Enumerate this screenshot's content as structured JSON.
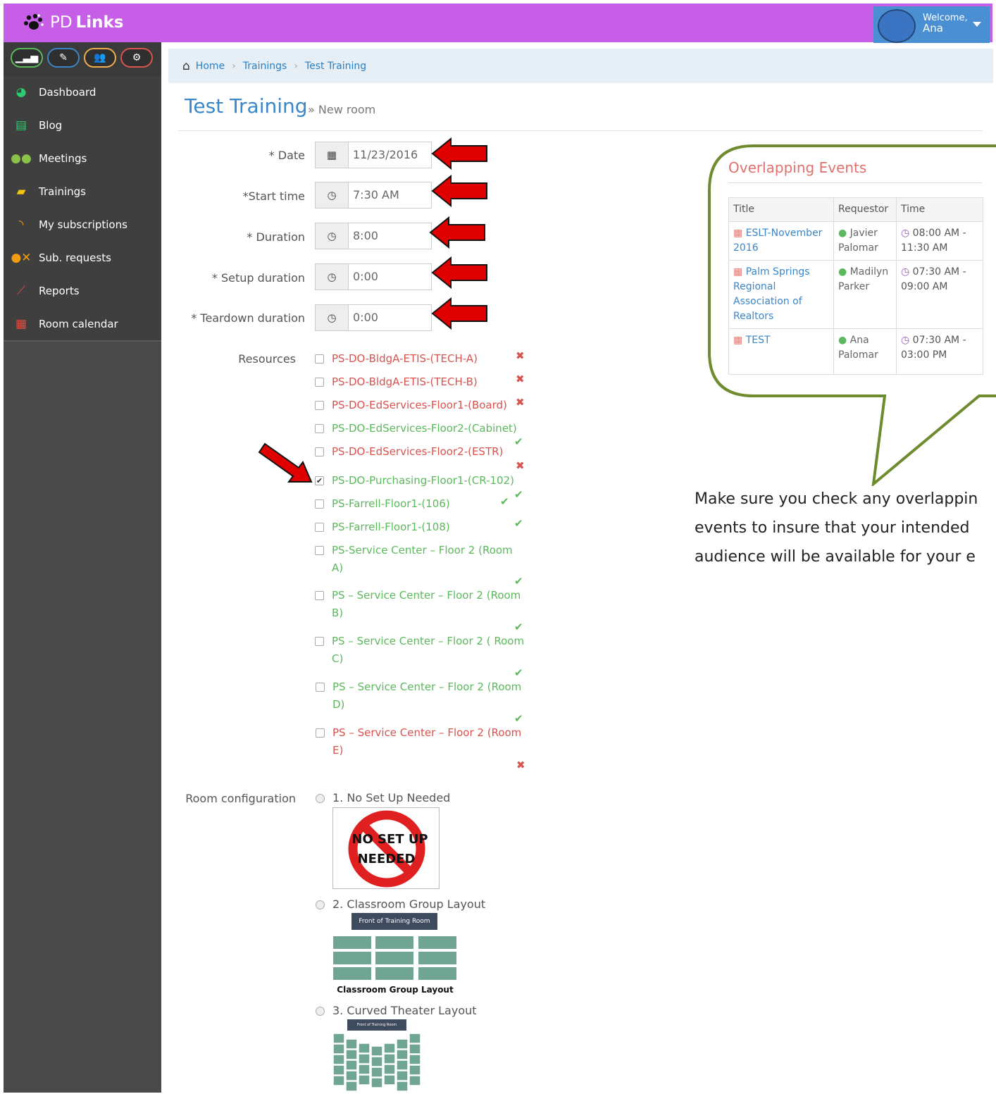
{
  "brand": {
    "name_light": "PD",
    "name_bold": "Links"
  },
  "user": {
    "welcome": "Welcome,",
    "name": "Ana"
  },
  "sidebar": {
    "items": [
      {
        "label": "Dashboard",
        "icon": "dashboard-icon",
        "color": "#2ecc71"
      },
      {
        "label": "Blog",
        "icon": "newspaper-icon",
        "color": "#2ecc71"
      },
      {
        "label": "Meetings",
        "icon": "users-icon",
        "color": "#8bc34a"
      },
      {
        "label": "Trainings",
        "icon": "book-icon",
        "color": "#f1c40f"
      },
      {
        "label": "My subscriptions",
        "icon": "rss-icon",
        "color": "#f39c12"
      },
      {
        "label": "Sub. requests",
        "icon": "user-x-icon",
        "color": "#f39c12"
      },
      {
        "label": "Reports",
        "icon": "chart-icon",
        "color": "#e74c3c"
      },
      {
        "label": "Room calendar",
        "icon": "calendar-icon",
        "color": "#e74c3c"
      }
    ]
  },
  "breadcrumb": {
    "home": "Home",
    "trainings": "Trainings",
    "current": "Test Training"
  },
  "page": {
    "title": "Test Training",
    "subtitle": "» New room"
  },
  "form": {
    "required": "*",
    "date": {
      "label": "Date",
      "value": "11/23/2016"
    },
    "start_time": {
      "label": "Start time",
      "value": "7:30 AM"
    },
    "duration": {
      "label": "Duration",
      "value": "8:00"
    },
    "setup_duration": {
      "label": "Setup duration",
      "value": "0:00"
    },
    "teardown_duration": {
      "label": "Teardown duration",
      "value": "0:00"
    },
    "resources_label": "Resources",
    "resources": [
      {
        "name": "PS-DO-BldgA-ETIS-(TECH-A)",
        "available": false,
        "checked": false
      },
      {
        "name": "PS-DO-BldgA-ETIS-(TECH-B)",
        "available": false,
        "checked": false
      },
      {
        "name": "PS-DO-EdServices-Floor1-(Board)",
        "available": false,
        "checked": false
      },
      {
        "name": "PS-DO-EdServices-Floor2-(Cabinet)",
        "available": true,
        "checked": false
      },
      {
        "name": "PS-DO-EdServices-Floor2-(ESTR)",
        "available": false,
        "checked": false
      },
      {
        "name": "PS-DO-Purchasing-Floor1-(CR-102)",
        "available": true,
        "checked": true
      },
      {
        "name": "PS-Farrell-Floor1-(106)",
        "available": true,
        "checked": false
      },
      {
        "name": "PS-Farrell-Floor1-(108)",
        "available": true,
        "checked": false
      },
      {
        "name": "PS-Service Center – Floor 2 (Room A)",
        "available": true,
        "checked": false
      },
      {
        "name": "PS – Service Center – Floor 2 (Room B)",
        "available": true,
        "checked": false
      },
      {
        "name": "PS – Service Center – Floor 2 ( Room C)",
        "available": true,
        "checked": false
      },
      {
        "name": "PS – Service Center – Floor 2 (Room D)",
        "available": true,
        "checked": false
      },
      {
        "name": "PS – Service Center – Floor 2 (Room E)",
        "available": false,
        "checked": false
      }
    ],
    "room_config_label": "Room configuration",
    "room_configs": [
      {
        "label": "1. No Set Up Needed",
        "image_text_1": "NO SET UP",
        "image_text_2": "NEEDED"
      },
      {
        "label": "2. Classroom Group Layout",
        "image_header": "Front of Training Room",
        "image_caption": "Classroom Group Layout"
      },
      {
        "label": "3. Curved Theater Layout",
        "image_header": "Front of Training Room"
      }
    ]
  },
  "overlapping": {
    "title": "Overlapping Events",
    "columns": [
      "Title",
      "Requestor",
      "Time"
    ],
    "rows": [
      {
        "title": "ESLT-November 2016",
        "requestor": "Javier Palomar",
        "time": "08:00 AM - 11:30 AM"
      },
      {
        "title": "Palm Springs Regional Association of Realtors",
        "requestor": "Madilyn Parker",
        "time": "07:30 AM - 09:00 AM"
      },
      {
        "title": "TEST",
        "requestor": "Ana Palomar",
        "time": "07:30 AM - 03:00 PM"
      }
    ]
  },
  "callout": {
    "line1": "Make sure you check any overlappin",
    "line2": "events to insure that your intended",
    "line3": "audience will be available for your e"
  },
  "colors": {
    "topbar": "#c65ee8",
    "sidebar": "#4a4a4a",
    "link": "#3a86c8",
    "unavailable": "#d9534f",
    "available": "#5cb85c",
    "callout_border": "#6e8b2e",
    "annotation_arrow": "#e00000"
  }
}
